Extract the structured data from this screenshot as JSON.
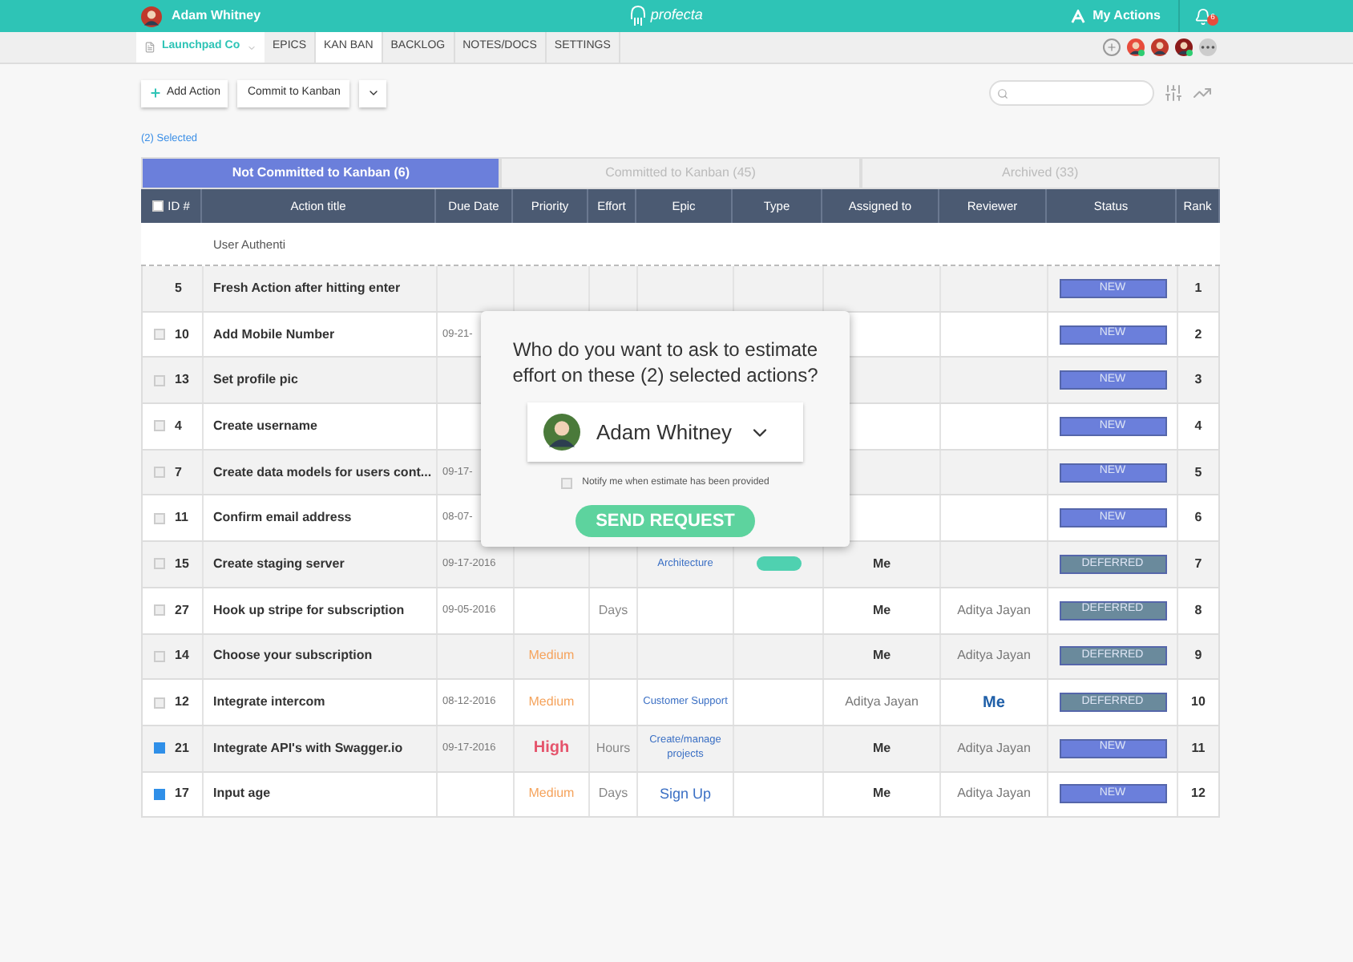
{
  "topbar": {
    "user": "Adam Whitney",
    "logo": "profecta",
    "my_actions": "My Actions",
    "notifications": "6"
  },
  "nav": {
    "project": "Launchpad Co",
    "tabs": [
      {
        "label": "EPICS",
        "selected": false
      },
      {
        "label": "KAN BAN",
        "selected": true
      },
      {
        "label": "BACKLOG",
        "selected": false
      },
      {
        "label": "NOTES/DOCS",
        "selected": false
      },
      {
        "label": "SETTINGS",
        "selected": false
      }
    ],
    "members": [
      {
        "color": "#e74c3c",
        "online": true
      },
      {
        "color": "#c0392b",
        "online": false
      },
      {
        "color": "#8b1a1a",
        "online": true
      }
    ]
  },
  "toolbar": {
    "add": "Add Action",
    "commit": "Commit to Kanban"
  },
  "selected_count": "(2) Selected",
  "tabs": [
    {
      "label": "Not Committed to Kanban (6)",
      "selected": true
    },
    {
      "label": "Committed to Kanban (45)",
      "selected": false
    },
    {
      "label": "Archived (33)",
      "selected": false
    }
  ],
  "table": {
    "columns": [
      "ID #",
      "Action title",
      "Due Date",
      "Priority",
      "Effort",
      "Epic",
      "Type",
      "Assigned to",
      "Reviewer",
      "Status",
      "Rank"
    ],
    "select_all": {
      "checked": false
    },
    "new_row": {
      "value": "User Authenti"
    },
    "rows": [
      {
        "kind": "draft",
        "id": "5",
        "title": "Fresh Action after hitting enter",
        "status": {
          "text": "NEW",
          "kind": "new"
        },
        "rank": "1"
      },
      {
        "kind": "action",
        "checked": false,
        "id": "10",
        "title": "Add Mobile Number",
        "due": "09-21-",
        "status": {
          "text": "NEW",
          "kind": "new"
        },
        "rank": "2"
      },
      {
        "kind": "action",
        "checked": false,
        "id": "13",
        "title": "Set profile pic",
        "status": {
          "text": "NEW",
          "kind": "new"
        },
        "rank": "3"
      },
      {
        "kind": "action",
        "checked": false,
        "id": "4",
        "title": "Create username",
        "status": {
          "text": "NEW",
          "kind": "new"
        },
        "rank": "4"
      },
      {
        "kind": "action",
        "checked": false,
        "id": "7",
        "title": "Create data models for users cont...",
        "due": "09-17-",
        "status": {
          "text": "NEW",
          "kind": "new"
        },
        "rank": "5"
      },
      {
        "kind": "action",
        "checked": false,
        "id": "11",
        "title": "Confirm email address",
        "due": "08-07-",
        "status": {
          "text": "NEW",
          "kind": "new"
        },
        "rank": "6"
      },
      {
        "kind": "action",
        "checked": false,
        "id": "15",
        "title": "Create staging server",
        "due": "09-17-2016",
        "epic": {
          "text": "Architecture",
          "large": false
        },
        "type": {
          "color": "#4fd1b0"
        },
        "assigned": {
          "text": "Me",
          "kind": "self"
        },
        "status": {
          "text": "DEFERRED",
          "kind": "deferred"
        },
        "rank": "7"
      },
      {
        "kind": "action",
        "checked": false,
        "id": "27",
        "title": "Hook up stripe for subscription",
        "due": "09-05-2016",
        "effort": "Days",
        "assigned": {
          "text": "Me",
          "kind": "self"
        },
        "reviewer": {
          "text": "Aditya Jayan",
          "kind": "user"
        },
        "status": {
          "text": "DEFERRED",
          "kind": "deferred"
        },
        "rank": "8"
      },
      {
        "kind": "action",
        "checked": false,
        "id": "14",
        "title": "Choose your subscription",
        "priority": {
          "text": "Medium",
          "kind": "medium"
        },
        "assigned": {
          "text": "Me",
          "kind": "self"
        },
        "reviewer": {
          "text": "Aditya Jayan",
          "kind": "user"
        },
        "status": {
          "text": "DEFERRED",
          "kind": "deferred"
        },
        "rank": "9"
      },
      {
        "kind": "action",
        "checked": false,
        "id": "12",
        "title": "Integrate intercom",
        "due": "08-12-2016",
        "priority": {
          "text": "Medium",
          "kind": "medium"
        },
        "epic": {
          "text": "Customer Support",
          "large": false
        },
        "assigned": {
          "text": "Aditya Jayan",
          "kind": "user"
        },
        "reviewer": {
          "text": "Me",
          "kind": "link"
        },
        "status": {
          "text": "DEFERRED",
          "kind": "deferred"
        },
        "rank": "10"
      },
      {
        "kind": "action",
        "checked": true,
        "id": "21",
        "title": "Integrate API's with Swagger.io",
        "due": "09-17-2016",
        "priority": {
          "text": "High",
          "kind": "high"
        },
        "effort": "Hours",
        "epic": {
          "text": "Create/manage projects",
          "large": false
        },
        "assigned": {
          "text": "Me",
          "kind": "self"
        },
        "reviewer": {
          "text": "Aditya Jayan",
          "kind": "user"
        },
        "status": {
          "text": "NEW",
          "kind": "new"
        },
        "rank": "11"
      },
      {
        "kind": "action",
        "checked": true,
        "id": "17",
        "title": "Input age",
        "priority": {
          "text": "Medium",
          "kind": "medium"
        },
        "effort": "Days",
        "epic": {
          "text": "Sign Up",
          "large": true
        },
        "assigned": {
          "text": "Me",
          "kind": "self"
        },
        "reviewer": {
          "text": "Aditya Jayan",
          "kind": "user"
        },
        "status": {
          "text": "NEW",
          "kind": "new"
        },
        "rank": "12"
      }
    ]
  },
  "popup": {
    "question": "Who do you want to ask to estimate effort on these (2) selected actions?",
    "person": "Adam Whitney",
    "notify": {
      "label": "Notify me when estimate has been provided",
      "checked": false
    },
    "button": "SEND REQUEST"
  }
}
